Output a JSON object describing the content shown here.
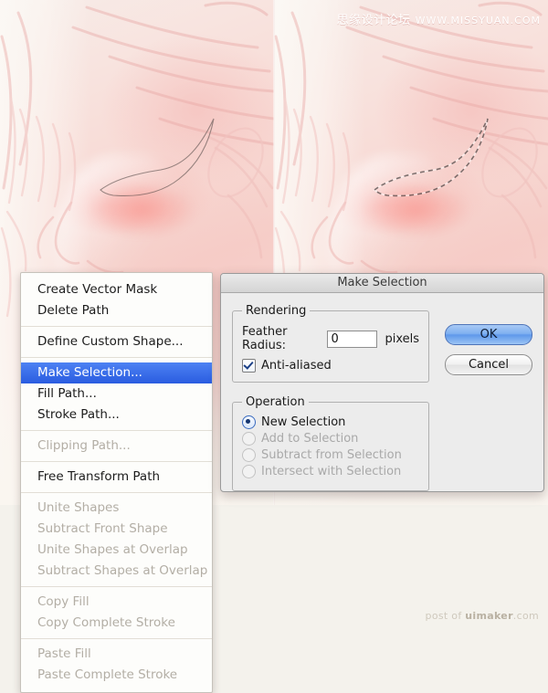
{
  "watermarks": {
    "top_zh": "思缘设计论坛",
    "top_url": "WWW.MISSYUAN.COM",
    "bottom_prefix": "post of ",
    "bottom_brand": "uimaker",
    "bottom_suffix": ".com"
  },
  "context_menu": {
    "groups": [
      {
        "items": [
          {
            "label": "Create Vector Mask",
            "state": "normal"
          },
          {
            "label": "Delete Path",
            "state": "normal"
          }
        ]
      },
      {
        "items": [
          {
            "label": "Define Custom Shape...",
            "state": "normal"
          }
        ]
      },
      {
        "items": [
          {
            "label": "Make Selection...",
            "state": "selected"
          },
          {
            "label": "Fill Path...",
            "state": "normal"
          },
          {
            "label": "Stroke Path...",
            "state": "normal"
          }
        ]
      },
      {
        "items": [
          {
            "label": "Clipping Path...",
            "state": "disabled"
          }
        ]
      },
      {
        "items": [
          {
            "label": "Free Transform Path",
            "state": "normal"
          }
        ]
      },
      {
        "items": [
          {
            "label": "Unite Shapes",
            "state": "disabled"
          },
          {
            "label": "Subtract Front Shape",
            "state": "disabled"
          },
          {
            "label": "Unite Shapes at Overlap",
            "state": "disabled"
          },
          {
            "label": "Subtract Shapes at Overlap",
            "state": "disabled"
          }
        ]
      },
      {
        "items": [
          {
            "label": "Copy Fill",
            "state": "disabled"
          },
          {
            "label": "Copy Complete Stroke",
            "state": "disabled"
          }
        ]
      },
      {
        "items": [
          {
            "label": "Paste Fill",
            "state": "disabled"
          },
          {
            "label": "Paste Complete Stroke",
            "state": "disabled"
          }
        ]
      }
    ]
  },
  "dialog": {
    "title": "Make Selection",
    "rendering": {
      "legend": "Rendering",
      "feather_label": "Feather Radius:",
      "feather_value": "0",
      "feather_units": "pixels",
      "antialiased_label": "Anti-aliased",
      "antialiased_checked": true
    },
    "operation": {
      "legend": "Operation",
      "options": [
        {
          "label": "New Selection",
          "checked": true,
          "disabled": false
        },
        {
          "label": "Add to Selection",
          "checked": false,
          "disabled": true
        },
        {
          "label": "Subtract from Selection",
          "checked": false,
          "disabled": true
        },
        {
          "label": "Intersect with Selection",
          "checked": false,
          "disabled": true
        }
      ]
    },
    "buttons": {
      "ok": "OK",
      "cancel": "Cancel"
    }
  },
  "colors": {
    "highlight_blue": "#2a5ce0",
    "default_button_blue": "#7fb0f0",
    "page_background": "#f4f2ec",
    "skin_base": "#f6cfc9"
  }
}
